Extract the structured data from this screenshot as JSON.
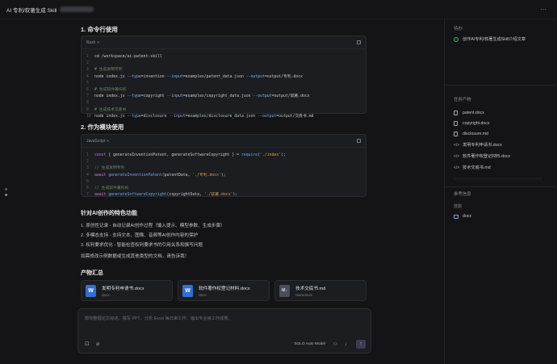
{
  "window": {
    "title": "AI 专利/软著生成 Skill",
    "more": "⋯"
  },
  "main": {
    "section1_title": "1. 命令行使用",
    "code1": {
      "lang": "Bash",
      "lines": [
        {
          "n": "1",
          "parts": [
            {
              "t": "cd /workspace/ai-patent-skill",
              "c": "plain"
            }
          ]
        },
        {
          "n": "2",
          "parts": [
            {
              "t": "",
              "c": "plain"
            }
          ]
        },
        {
          "n": "3",
          "parts": [
            {
              "t": "# 生成发明专利",
              "c": "cmt"
            }
          ]
        },
        {
          "n": "4",
          "parts": [
            {
              "t": "node index.js ",
              "c": "plain"
            },
            {
              "t": "--type",
              "c": "flag"
            },
            {
              "t": "=invention ",
              "c": "plain"
            },
            {
              "t": "--input",
              "c": "flag"
            },
            {
              "t": "=examples/patent_data.json ",
              "c": "plain"
            },
            {
              "t": "--output",
              "c": "flag"
            },
            {
              "t": "=output/专利.docx",
              "c": "plain"
            }
          ]
        },
        {
          "n": "5",
          "parts": [
            {
              "t": "",
              "c": "plain"
            }
          ]
        },
        {
          "n": "6",
          "parts": [
            {
              "t": "# 生成软件著作权",
              "c": "cmt"
            }
          ]
        },
        {
          "n": "7",
          "parts": [
            {
              "t": "node index.js ",
              "c": "plain"
            },
            {
              "t": "--type",
              "c": "flag"
            },
            {
              "t": "=copyright ",
              "c": "plain"
            },
            {
              "t": "--input",
              "c": "flag"
            },
            {
              "t": "=examples/copyright_data.json ",
              "c": "plain"
            },
            {
              "t": "--output",
              "c": "flag"
            },
            {
              "t": "=output/软著.docx",
              "c": "plain"
            }
          ]
        },
        {
          "n": "8",
          "parts": [
            {
              "t": "",
              "c": "plain"
            }
          ]
        },
        {
          "n": "9",
          "parts": [
            {
              "t": "# 生成技术交底书",
              "c": "cmt"
            }
          ]
        },
        {
          "n": "10",
          "parts": [
            {
              "t": "node index.js ",
              "c": "plain"
            },
            {
              "t": "--type",
              "c": "flag"
            },
            {
              "t": "=disclosure ",
              "c": "plain"
            },
            {
              "t": "--input",
              "c": "flag"
            },
            {
              "t": "=examples/disclosure_data.json ",
              "c": "plain"
            },
            {
              "t": "--output",
              "c": "flag"
            },
            {
              "t": "=output/交底书.md",
              "c": "plain"
            }
          ]
        }
      ]
    },
    "section2_title": "2. 作为模块使用",
    "code2": {
      "lang": "JavaScript",
      "lines": [
        {
          "n": "1",
          "parts": [
            {
              "t": "const",
              "c": "kw"
            },
            {
              "t": " { generateInventionPatent, generateSoftwareCopyright } = ",
              "c": "plain"
            },
            {
              "t": "require",
              "c": "fn"
            },
            {
              "t": "(",
              "c": "plain"
            },
            {
              "t": "'./index'",
              "c": "str"
            },
            {
              "t": ");",
              "c": "plain"
            }
          ]
        },
        {
          "n": "2",
          "parts": [
            {
              "t": "",
              "c": "plain"
            }
          ]
        },
        {
          "n": "3",
          "parts": [
            {
              "t": "// 生成发明专利",
              "c": "cmt"
            }
          ]
        },
        {
          "n": "4",
          "parts": [
            {
              "t": "await",
              "c": "kw"
            },
            {
              "t": " ",
              "c": "plain"
            },
            {
              "t": "generateInventionPatent",
              "c": "fn"
            },
            {
              "t": "(patentData, ",
              "c": "plain"
            },
            {
              "t": "'./专利.docx'",
              "c": "str"
            },
            {
              "t": ");",
              "c": "plain"
            }
          ]
        },
        {
          "n": "5",
          "parts": [
            {
              "t": "",
              "c": "plain"
            }
          ]
        },
        {
          "n": "6",
          "parts": [
            {
              "t": "// 生成软件著作权",
              "c": "cmt"
            }
          ]
        },
        {
          "n": "7",
          "parts": [
            {
              "t": "await",
              "c": "kw"
            },
            {
              "t": " ",
              "c": "plain"
            },
            {
              "t": "generateSoftwareCopyright",
              "c": "fn"
            },
            {
              "t": "(copyrightData, ",
              "c": "plain"
            },
            {
              "t": "'./软著.docx'",
              "c": "str"
            },
            {
              "t": ");",
              "c": "plain"
            }
          ]
        }
      ]
    },
    "features_title": "针对AI创作的特色功能",
    "features": [
      "1. 原创性记录 - 自动记录AI创作过程（输入提示、模型参数、生成步骤）",
      "2. 多模态支持 - 支持文本、图像、音频等AI创作内容的保护",
      "3. 权利要求优化 - 智能检查权利要求书的引用关系和撰写问题"
    ],
    "closing": "如需修改示例数据或生成其他类型的文档，请告诉我！",
    "outputs_title": "产物汇总",
    "outputs": [
      {
        "name": "发明专利申请书.docx",
        "type": "docx",
        "icon": "W"
      },
      {
        "name": "软件著作权登记材料.docx",
        "type": "docx",
        "icon": "W"
      },
      {
        "name": "技术交底书.md",
        "type": "Markdown",
        "icon": "M↓"
      }
    ]
  },
  "chat": {
    "placeholder": "帮你整理论文综述、撰写 PPT、分析 Excel 每日审工作、输出专业级工作成果。",
    "model": "SOLO Auto Model",
    "send": "↑"
  },
  "right": {
    "todo_title": "待办",
    "todo_item": "创作AI专利/软著生成Skill介绍文章",
    "artifacts_title": "任务产物",
    "files": [
      {
        "name": "patent.docx",
        "icon": "doc"
      },
      {
        "name": "copyright.docx",
        "icon": "doc"
      },
      {
        "name": "disclosure.md",
        "icon": "doc"
      },
      {
        "name": "发明专利申请书.docx",
        "icon": "code"
      },
      {
        "name": "软件著作权登记材料.docx",
        "icon": "code"
      },
      {
        "name": "技术交底书.md",
        "icon": "code"
      }
    ],
    "ref_title": "参考信息",
    "skills_label": "技能",
    "skill_item": "docx"
  }
}
